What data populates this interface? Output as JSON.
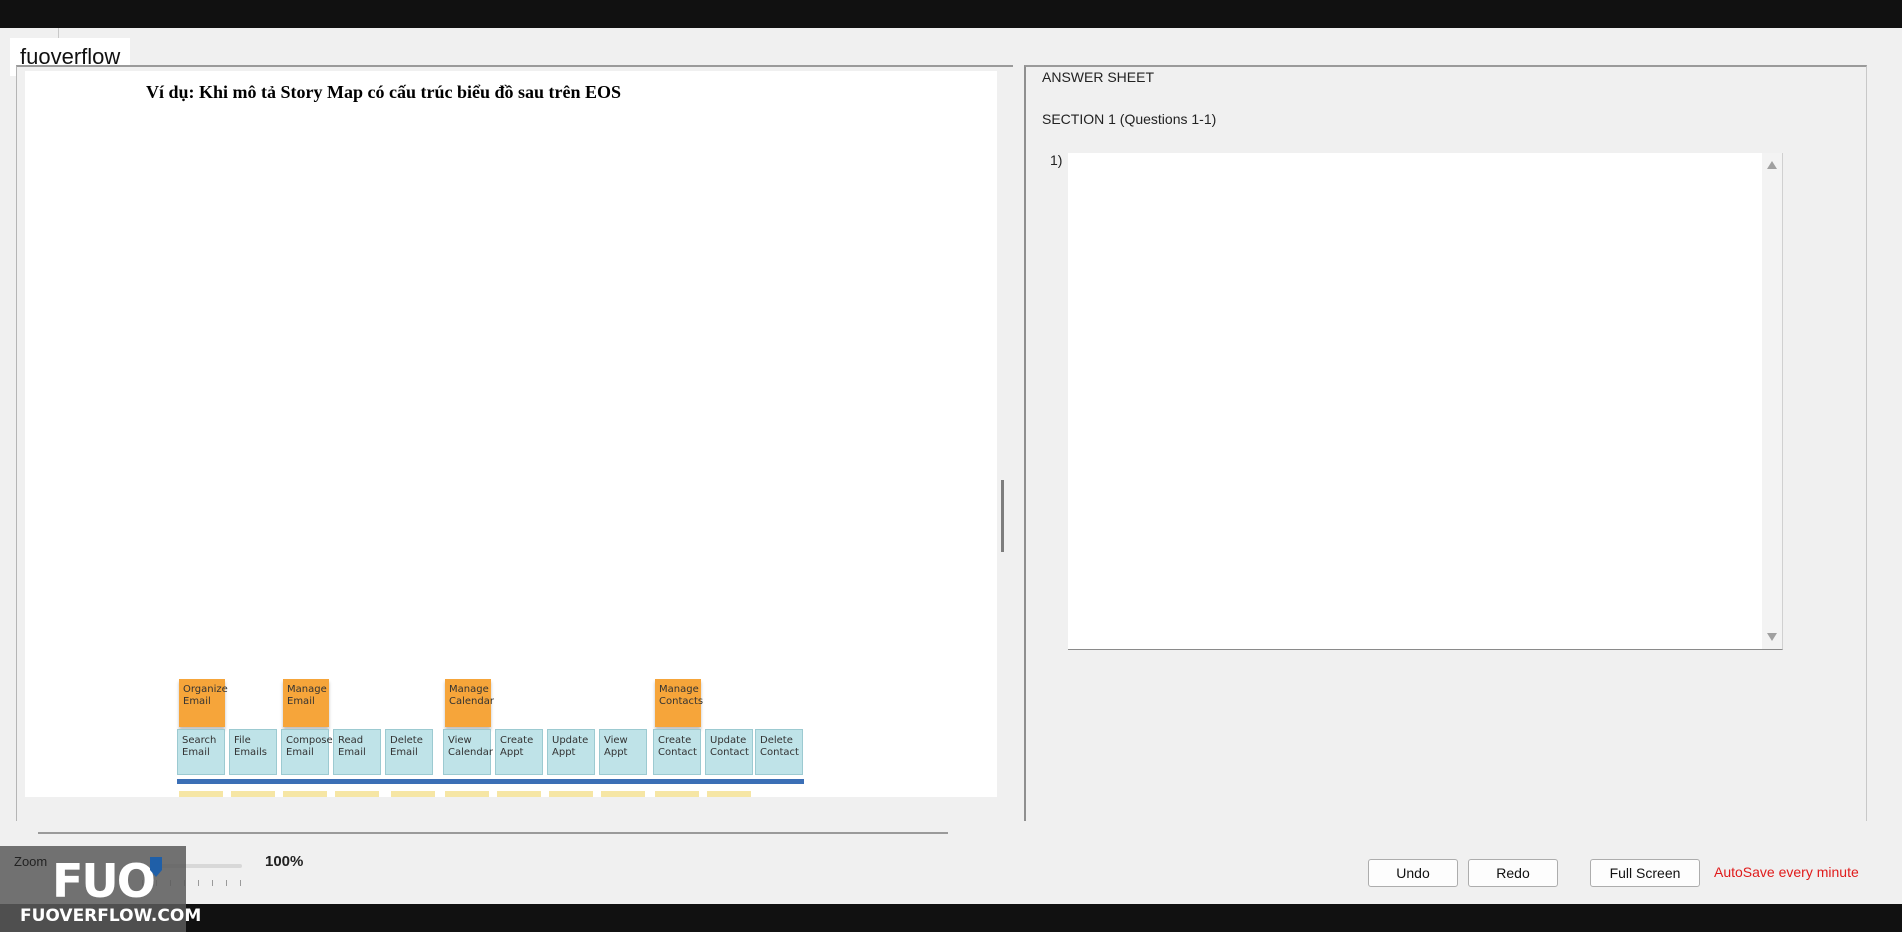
{
  "brand": {
    "tab_label": "fuoverflow"
  },
  "question": {
    "heading": "Ví dụ: Khi mô tả Story Map có cấu trúc biểu đồ sau trên EOS",
    "story_map": {
      "activities": [
        "Organize Email",
        "Manage Email",
        "Manage Calendar",
        "Manage Contacts"
      ],
      "tasks": [
        "Search Email",
        "File Emails",
        "Compose Email",
        "Read Email",
        "Delete Email",
        "View Calendar",
        "Create Appt",
        "Update Appt",
        "View Appt",
        "Create Contact",
        "Update Contact",
        "Delete Contact"
      ]
    }
  },
  "answer_sheet": {
    "title": "ANSWER SHEET",
    "section": "SECTION 1 (Questions 1-1)",
    "question_number": "1)",
    "answer_value": ""
  },
  "toolbar": {
    "zoom_label": "Zoom",
    "zoom_value": "100%",
    "zoom_level": 0.0,
    "undo_label": "Undo",
    "redo_label": "Redo",
    "fullscreen_label": "Full Screen",
    "autosave_text": "AutoSave every minute"
  },
  "watermark": {
    "logo": "FUO",
    "text": "FUOVERFLOW.COM"
  },
  "colors": {
    "autosave": "#e01b1b",
    "zoom_thumb": "#1f5fa8",
    "sticky_orange": "#f6a53a",
    "sticky_blue": "#bfe3e8",
    "timeline": "#3b6fb6"
  }
}
